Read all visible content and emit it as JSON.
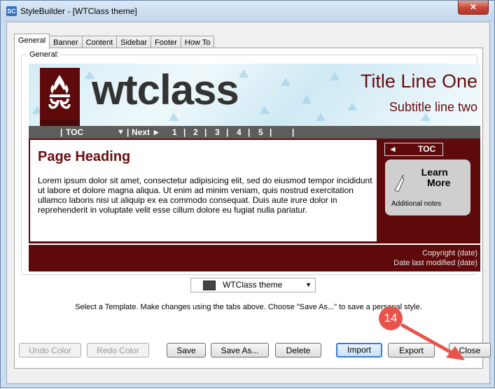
{
  "window": {
    "title": "StyleBuilder - [WTClass theme]",
    "app_icon": "SC",
    "close_glyph": "✕"
  },
  "tabs": [
    {
      "label": "General",
      "active": true
    },
    {
      "label": "Banner"
    },
    {
      "label": "Content"
    },
    {
      "label": "Sidebar"
    },
    {
      "label": "Footer"
    },
    {
      "label": "How To"
    }
  ],
  "general": {
    "group_label": "General:",
    "preview": {
      "logo_text": "wtclass",
      "title_line_one": "Title Line One",
      "subtitle": "Subtitle line two",
      "nav": {
        "toc": "TOC",
        "toc_arrow": "▼",
        "next": "Next ►",
        "pages": [
          "1",
          "2",
          "3",
          "4",
          "5"
        ],
        "divider": "|"
      },
      "heading": "Page Heading",
      "body": "Lorem ipsum dolor sit amet, consectetur adipisicing elit, sed do eiusmod tempor incididunt ut labore et dolore magna aliqua. Ut enim ad minim veniam, quis nostrud exercitation ullamco laboris nisi ut aliquip ex ea commodo consequat. Duis aute irure dolor in reprehenderit in voluptate velit esse cillum dolore eu fugiat nulla pariatur.",
      "sidebar": {
        "toc_arrow": "◄",
        "toc_label": "TOC",
        "learn_line1": "Learn",
        "learn_line2": "More",
        "notes": "Additional notes"
      },
      "footer": {
        "copyright": "Copyright (date)",
        "modified": "Date last modified (date)"
      }
    }
  },
  "template_select": {
    "value": "WTClass theme",
    "arrow": "▼"
  },
  "hint": "Select a Template. Make changes using the tabs above. Choose \"Save As...\" to save a personal style.",
  "buttons": {
    "undo_color": "Undo Color",
    "redo_color": "Redo Color",
    "save": "Save",
    "save_as": "Save As...",
    "delete": "Delete",
    "import": "Import",
    "export": "Export",
    "close": "Close"
  },
  "annotation": {
    "step_number": "14",
    "color": "#e8544c"
  },
  "colors": {
    "brand_maroon": "#5e0a0a",
    "title_red": "#6a0d0d",
    "nav_gray": "#5d5d5d"
  }
}
